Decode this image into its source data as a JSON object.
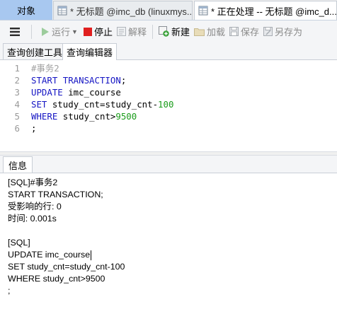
{
  "tabs": {
    "objects": "对象",
    "doc1": "* 无标题 @imc_db (linuxmys...",
    "doc2": "* 正在处理 -- 无标题 @imc_d..."
  },
  "toolbar": {
    "run": "运行",
    "stop": "停止",
    "explain": "解释",
    "new": "新建",
    "load": "加载",
    "save": "保存",
    "save_as": "另存为"
  },
  "subtabs": {
    "builder": "查询创建工具",
    "editor": "查询编辑器"
  },
  "editor": {
    "lines": [
      {
        "num": "1",
        "tokens": [
          {
            "t": "#事务2",
            "c": "cm"
          }
        ]
      },
      {
        "num": "2",
        "tokens": [
          {
            "t": "START TRANSACTION",
            "c": "kw"
          },
          {
            "t": ";",
            "c": "plain"
          }
        ]
      },
      {
        "num": "3",
        "tokens": [
          {
            "t": "UPDATE",
            "c": "kw"
          },
          {
            "t": " imc_course",
            "c": "plain"
          }
        ]
      },
      {
        "num": "4",
        "tokens": [
          {
            "t": "SET",
            "c": "kw"
          },
          {
            "t": " study_cnt=study_cnt-",
            "c": "plain"
          },
          {
            "t": "100",
            "c": "num"
          }
        ]
      },
      {
        "num": "5",
        "tokens": [
          {
            "t": "WHERE",
            "c": "kw"
          },
          {
            "t": " study_cnt>",
            "c": "plain"
          },
          {
            "t": "9500",
            "c": "num"
          }
        ]
      },
      {
        "num": "6",
        "tokens": [
          {
            "t": ";",
            "c": "plain"
          }
        ]
      }
    ]
  },
  "info": {
    "tab_label": "信息",
    "output_lines": [
      "[SQL]#事务2",
      "START TRANSACTION;",
      "受影响的行: 0",
      "时间: 0.001s",
      "",
      "[SQL]",
      "UPDATE imc_course",
      "SET study_cnt=study_cnt-100",
      "WHERE study_cnt>9500",
      ";"
    ]
  },
  "colors": {
    "keyword": "#1616c4",
    "comment": "#a0a0a0",
    "number": "#1a9c1a",
    "objects_tab": "#a8c8f0"
  }
}
